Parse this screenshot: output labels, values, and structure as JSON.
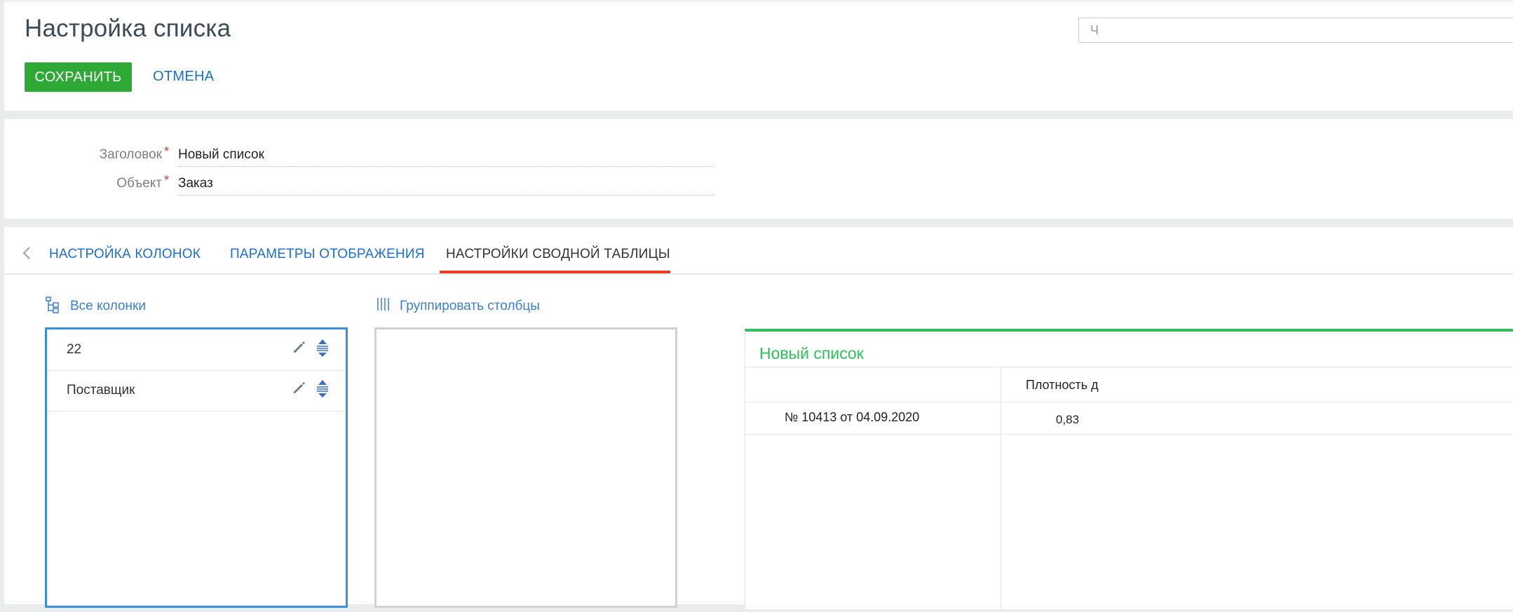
{
  "header": {
    "title": "Настройка списка",
    "save_label": "СОХРАНИТЬ",
    "cancel_label": "ОТМЕНА",
    "right_input_value": "Ч"
  },
  "fields": {
    "title_label": "Заголовок",
    "title_value": "Новый список",
    "object_label": "Объект",
    "object_value": "Заказ",
    "required_mark": "*"
  },
  "tabs": [
    {
      "label": "НАСТРОЙКА КОЛОНОК",
      "active": false
    },
    {
      "label": "ПАРАМЕТРЫ ОТОБРАЖЕНИЯ",
      "active": false
    },
    {
      "label": "НАСТРОЙКИ СВОДНОЙ ТАБЛИЦЫ",
      "active": true
    }
  ],
  "all_columns": {
    "header": "Все колонки",
    "icon": "tree-icon",
    "items": [
      {
        "label": "22"
      },
      {
        "label": "Поставщик"
      }
    ]
  },
  "group_columns": {
    "header": "Группировать столбцы",
    "icon": "columns-icon"
  },
  "preview": {
    "title": "Новый список",
    "column_header": "Плотность д",
    "row_order": "№ 10413 от 04.09.2020",
    "row_value": "0,83"
  },
  "colors": {
    "save_button": "#2ea935",
    "link": "#1b6fd1",
    "active_tab_underline": "#ef3b24",
    "list_border_active": "#3a8ede",
    "preview_accent": "#2ec05b",
    "required": "#e53935"
  }
}
